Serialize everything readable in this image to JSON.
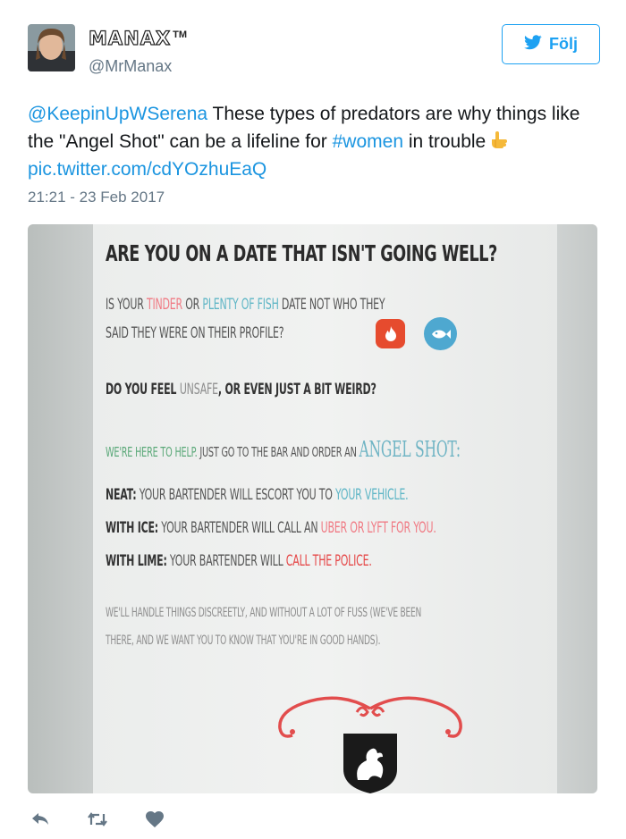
{
  "user": {
    "display_name": "MANAX",
    "trademark": "TM",
    "handle": "@MrManax"
  },
  "follow_button": {
    "label": "Följ",
    "icon": "twitter-bird-icon"
  },
  "tweet": {
    "mention": "@KeepinUpWSerena",
    "text_part1": " These types of predators are why things like the \"Angel Shot\" can be a lifeline for ",
    "hashtag": "#women",
    "text_part2": " in trouble",
    "emoji": "pointing-hand-emoji",
    "link": "pic.twitter.com/cdYOzhuEaQ",
    "timestamp": "21:21 - 23 Feb 2017"
  },
  "poster": {
    "title": "ARE YOU ON A DATE THAT ISN'T GOING WELL?",
    "line1_a": "IS YOUR ",
    "line1_tinder": "TINDER",
    "line1_b": " OR ",
    "line1_pof": "PLENTY OF FISH",
    "line1_c": " DATE NOT WHO THEY",
    "line2": "SAID THEY WERE ON THEIR PROFILE?",
    "line3_a": "DO YOU FEEL ",
    "line3_unsafe": "UNSAFE",
    "line3_b": ", OR EVEN JUST A BIT WEIRD?",
    "line4_a": "WE'RE HERE TO HELP.",
    "line4_b": " JUST GO TO THE BAR AND ORDER AN ",
    "line4_angel": "ANGEL SHOT:",
    "neat_label": "NEAT:",
    "neat_text": " YOUR BARTENDER WILL ESCORT YOU TO ",
    "neat_hl": "YOUR VEHICLE.",
    "ice_label": "WITH ICE:",
    "ice_text": " YOUR BARTENDER WILL CALL AN ",
    "ice_hl": "UBER OR LYFT FOR YOU.",
    "lime_label": "WITH LIME:",
    "lime_text": " YOUR BARTENDER WILL ",
    "lime_hl": "CALL THE POLICE.",
    "footer1": "WE'LL HANDLE THINGS DISCREETLY, AND WITHOUT A LOT OF FUSS (WE'VE BEEN",
    "footer2": "THERE, AND WE WANT YOU TO KNOW THAT YOU'RE IN GOOD HANDS)."
  },
  "actions": [
    {
      "name": "reply-icon"
    },
    {
      "name": "retweet-icon"
    },
    {
      "name": "like-icon"
    }
  ],
  "colors": {
    "accent": "#1da1f2",
    "link": "#1b95e0",
    "muted": "#657786"
  }
}
